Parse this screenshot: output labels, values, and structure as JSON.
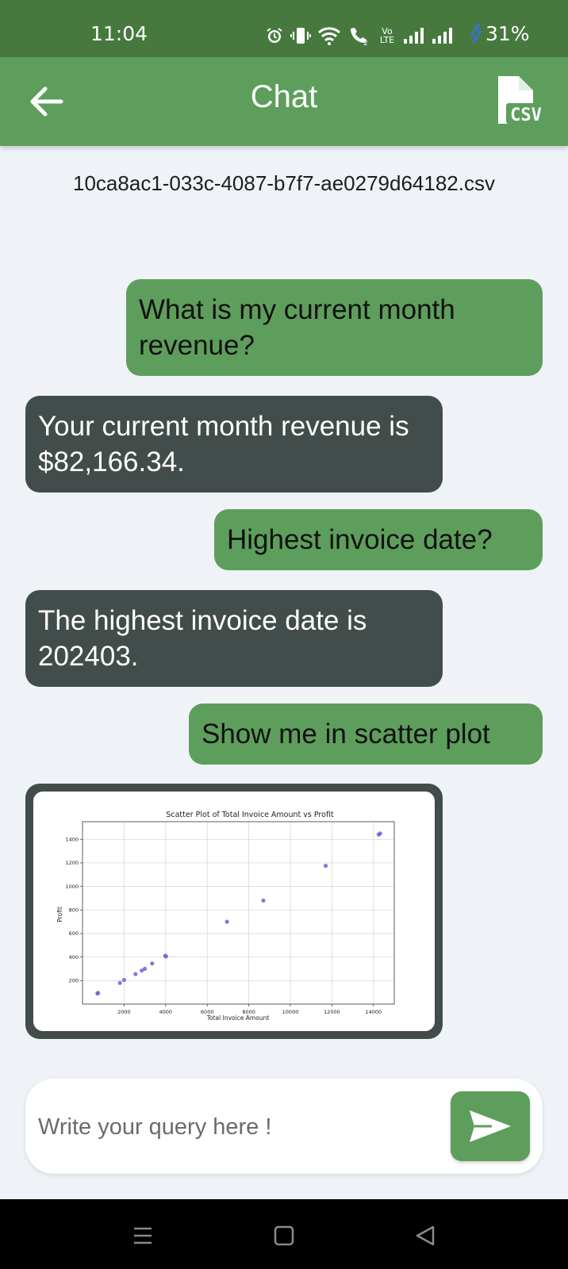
{
  "status_bar": {
    "time": "11:04",
    "battery": "31%",
    "lte": "Vo LTE",
    "sim": "2"
  },
  "app_bar": {
    "title": "Chat",
    "csv_label": "CSV"
  },
  "file_name": "10ca8ac1-033c-4087-b7f7-ae0279d64182.csv",
  "messages": [
    {
      "role": "user",
      "text": "What is my current month revenue?"
    },
    {
      "role": "bot",
      "text": "Your current month revenue is $82,166.34."
    },
    {
      "role": "user",
      "text": "Highest invoice date?"
    },
    {
      "role": "bot",
      "text": "The highest invoice date is 202403."
    },
    {
      "role": "user",
      "text": "Show me in scatter plot"
    }
  ],
  "chart_data": {
    "type": "scatter",
    "title": "Scatter Plot of Total Invoice Amount vs Profit",
    "xlabel": "Total Invoice Amount",
    "ylabel": "Profit",
    "xlim": [
      0,
      15000
    ],
    "ylim": [
      0,
      1550
    ],
    "xticks": [
      2000,
      4000,
      6000,
      8000,
      10000,
      12000,
      14000
    ],
    "yticks": [
      200,
      400,
      600,
      800,
      1000,
      1200,
      1400
    ],
    "grid": true,
    "point_color": "#6b63d6",
    "points": [
      {
        "x": 720,
        "y": 90
      },
      {
        "x": 750,
        "y": 95
      },
      {
        "x": 1800,
        "y": 180
      },
      {
        "x": 2000,
        "y": 205
      },
      {
        "x": 2550,
        "y": 255
      },
      {
        "x": 2850,
        "y": 285
      },
      {
        "x": 3000,
        "y": 300
      },
      {
        "x": 3350,
        "y": 345
      },
      {
        "x": 3980,
        "y": 410
      },
      {
        "x": 4020,
        "y": 405
      },
      {
        "x": 6950,
        "y": 700
      },
      {
        "x": 8700,
        "y": 880
      },
      {
        "x": 11700,
        "y": 1175
      },
      {
        "x": 14250,
        "y": 1440
      },
      {
        "x": 14320,
        "y": 1450
      }
    ]
  },
  "input": {
    "placeholder": "Write your query here !"
  },
  "colors": {
    "header": "#5e9e5c",
    "status": "#47793f",
    "bot_bubble": "#424c4a",
    "background": "#eff3f8"
  }
}
